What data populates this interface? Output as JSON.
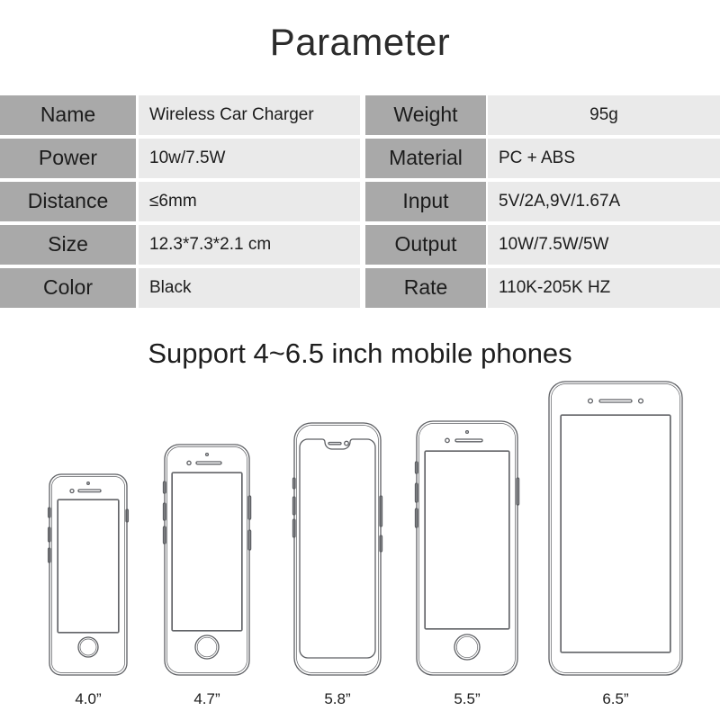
{
  "page": {
    "title": "Parameter",
    "support_heading": "Support 4~6.5 inch mobile phones",
    "label_bg": "#a9a9a9",
    "value_bg": "#eaeaea",
    "text_color": "#1c1c1c",
    "background": "#ffffff"
  },
  "spec_table": {
    "rows": [
      {
        "left": {
          "label": "Name",
          "value": "Wireless Car Charger"
        },
        "right": {
          "label": "Weight",
          "value": "95g",
          "align": "center"
        }
      },
      {
        "left": {
          "label": "Power",
          "value": "10w/7.5W"
        },
        "right": {
          "label": "Material",
          "value": "PC + ABS"
        }
      },
      {
        "left": {
          "label": "Distance",
          "value": "≤6mm"
        },
        "right": {
          "label": "Input",
          "value": "5V/2A,9V/1.67A"
        }
      },
      {
        "left": {
          "label": "Size",
          "value": "12.3*7.3*2.1 cm"
        },
        "right": {
          "label": "Output",
          "value": "10W/7.5W/5W"
        }
      },
      {
        "left": {
          "label": "Color",
          "value": "Black"
        },
        "right": {
          "label": "Rate",
          "value": "110K-205K HZ"
        }
      }
    ]
  },
  "phones": [
    {
      "caption": "4.0”",
      "style": "home-button",
      "icon": "phone-outline-icon"
    },
    {
      "caption": "4.7”",
      "style": "home-button",
      "icon": "phone-outline-icon"
    },
    {
      "caption": "5.8”",
      "style": "notch",
      "icon": "phone-notch-outline-icon"
    },
    {
      "caption": "5.5”",
      "style": "home-button",
      "icon": "phone-outline-icon"
    },
    {
      "caption": "6.5”",
      "style": "bezel-full",
      "icon": "phablet-outline-icon"
    }
  ]
}
